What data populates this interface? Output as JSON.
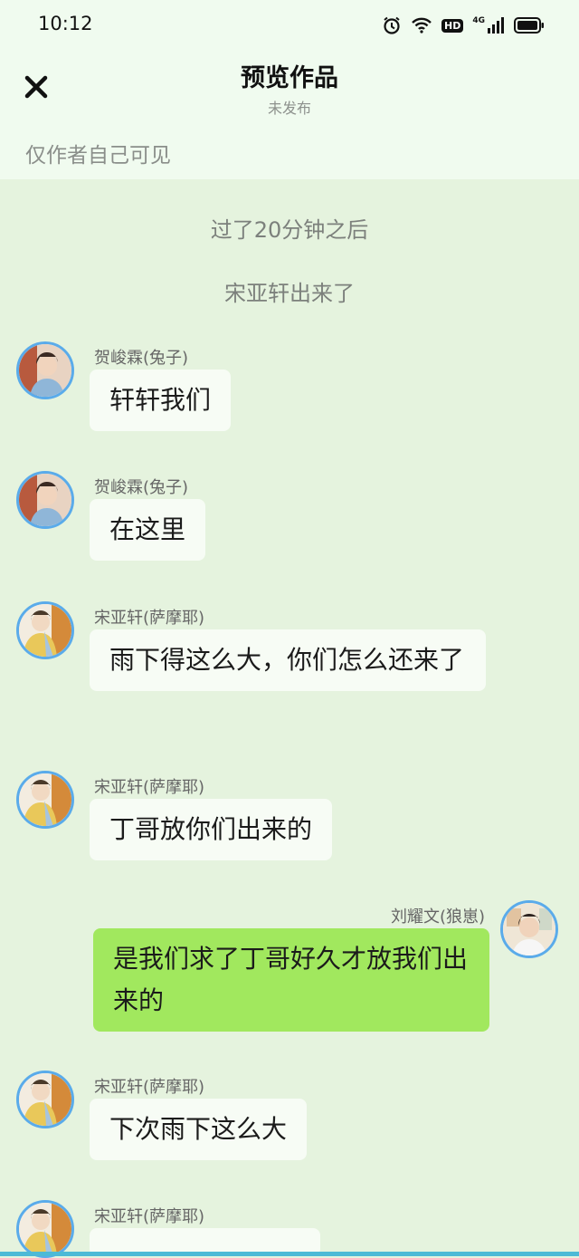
{
  "status_bar": {
    "time": "10:12",
    "hd_label": "HD",
    "network_label": "4G"
  },
  "header": {
    "title": "预览作品",
    "subtitle": "未发布"
  },
  "visibility_note": "仅作者自己可见",
  "narration": [
    "过了20分钟之后",
    "宋亚轩出来了"
  ],
  "messages": [
    {
      "sender": "贺峻霖(兔子)",
      "text": "轩轩我们",
      "side": "left"
    },
    {
      "sender": "贺峻霖(兔子)",
      "text": "在这里",
      "side": "left"
    },
    {
      "sender": "宋亚轩(萨摩耶)",
      "text": "雨下得这么大，你们怎么还来了",
      "side": "left"
    },
    {
      "sender": "宋亚轩(萨摩耶)",
      "text": "丁哥放你们出来的",
      "side": "left"
    },
    {
      "sender": "刘耀文(狼崽)",
      "text": "是我们求了丁哥好久才放我们出来的",
      "side": "right"
    },
    {
      "sender": "宋亚轩(萨摩耶)",
      "text": "下次雨下这么大",
      "side": "left"
    },
    {
      "sender": "宋亚轩(萨摩耶)",
      "text": "",
      "side": "left"
    }
  ],
  "colors": {
    "accent_ring": "#5aabea",
    "right_bubble": "#a1e85e",
    "background": "#e5f3de"
  }
}
